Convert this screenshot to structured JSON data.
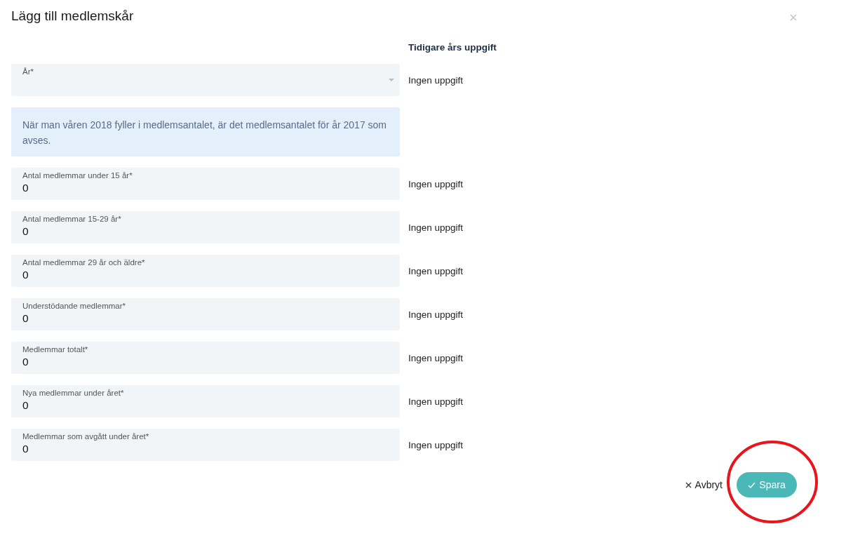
{
  "dialog": {
    "title": "Lägg till medlemskår"
  },
  "previous_header": "Tidigare års uppgift",
  "year_field": {
    "label": "År*",
    "previous": "Ingen uppgift"
  },
  "info": "När man våren 2018 fyller i medlemsantalet, är det medlemsantalet för år 2017 som avses.",
  "fields": [
    {
      "label": "Antal medlemmar under 15 år*",
      "value": "0",
      "previous": "Ingen uppgift"
    },
    {
      "label": "Antal medlemmar 15-29 år*",
      "value": "0",
      "previous": "Ingen uppgift"
    },
    {
      "label": "Antal medlemmar 29 år och äldre*",
      "value": "0",
      "previous": "Ingen uppgift"
    },
    {
      "label": "Understödande medlemmar*",
      "value": "0",
      "previous": "Ingen uppgift"
    },
    {
      "label": "Medlemmar totalt*",
      "value": "0",
      "previous": "Ingen uppgift"
    },
    {
      "label": "Nya medlemmar under året*",
      "value": "0",
      "previous": "Ingen uppgift"
    },
    {
      "label": "Medlemmar som avgått under året*",
      "value": "0",
      "previous": "Ingen uppgift"
    }
  ],
  "buttons": {
    "cancel": "Avbryt",
    "save": "Spara"
  }
}
